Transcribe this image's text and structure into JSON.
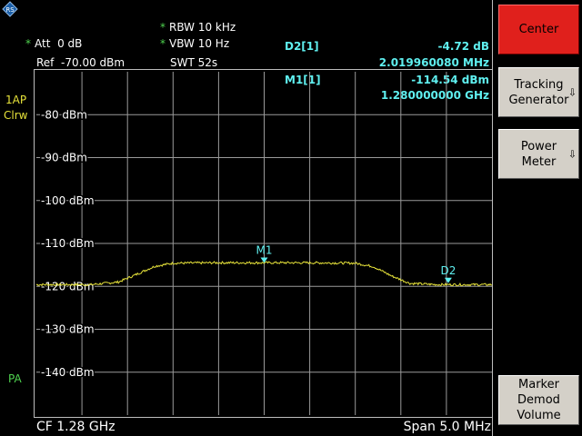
{
  "header": {
    "att_label": "Att",
    "att_value": "0 dB",
    "ref_label": "Ref",
    "ref_value": "-70.00 dBm",
    "rbw_label": "RBW",
    "rbw_value": "10 kHz",
    "vbw_label": "VBW",
    "vbw_value": "10 Hz",
    "swt_label": "SWT",
    "swt_value": "52s",
    "star": "*"
  },
  "markers": {
    "delta": {
      "label": "D2[1]",
      "level": "-4.72 dB",
      "freq": "2.019960080 MHz",
      "tag": "D2"
    },
    "main": {
      "label": "M1[1]",
      "level": "-114.54 dBm",
      "freq": "1.280000000 GHz",
      "tag": "M1"
    }
  },
  "trace_indicator": {
    "line1": "1AP",
    "line2": "Clrw"
  },
  "pa_indicator": "PA",
  "footer": {
    "center": "CF 1.28 GHz",
    "span": "Span 5.0 MHz"
  },
  "softkeys": [
    {
      "label": "Center",
      "active": true,
      "submenu": false
    },
    {
      "label": "Tracking\nGenerator",
      "active": false,
      "submenu": true
    },
    {
      "label": "Power\nMeter",
      "active": false,
      "submenu": true
    },
    {
      "label": "Marker\nDemod\nVolume",
      "active": false,
      "submenu": false
    }
  ],
  "chart_data": {
    "type": "line",
    "ylabel_unit": "dBm",
    "y_tick_labels": [
      "-80 dBm",
      "-90 dBm",
      "-100 dBm",
      "-110 dBm",
      "-120 dBm",
      "-130 dBm",
      "-140 dBm"
    ],
    "y_ticks": [
      -80,
      -90,
      -100,
      -110,
      -120,
      -130,
      -140
    ],
    "ylim": [
      -150,
      -70
    ],
    "x_center_ghz": 1.28,
    "x_span_mhz": 5.0,
    "xlim_mhz_offset": [
      -2.5,
      2.5
    ],
    "grid": true,
    "series": [
      {
        "color": "#e6e23a",
        "x_mhz_offset": [
          -2.5,
          -1.9,
          -1.6,
          -1.4,
          -1.2,
          -1.0,
          -0.5,
          0.0,
          0.5,
          1.0,
          1.2,
          1.4,
          1.6,
          1.9,
          2.5
        ],
        "y_dbm": [
          -119.6,
          -119.6,
          -119.0,
          -117.2,
          -115.3,
          -114.6,
          -114.5,
          -114.5,
          -114.5,
          -114.6,
          -115.4,
          -117.6,
          -119.3,
          -119.6,
          -119.6
        ]
      }
    ],
    "marker_points": [
      {
        "tag": "M1",
        "x_mhz_offset": 0.0,
        "y_dbm": -114.54
      },
      {
        "tag": "D2",
        "x_mhz_offset": 2.02,
        "y_dbm": -119.26
      }
    ]
  }
}
